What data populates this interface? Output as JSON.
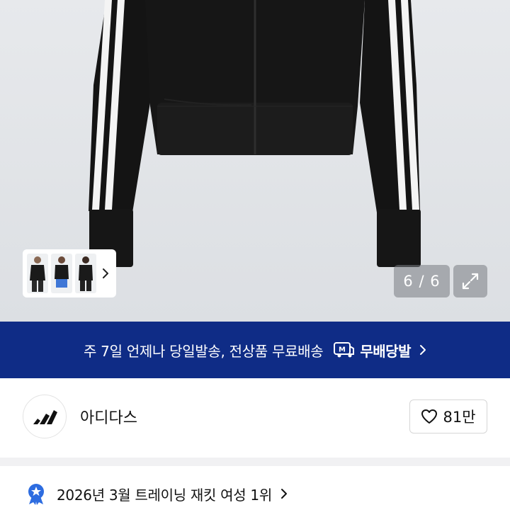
{
  "gallery": {
    "counter": "6 / 6",
    "thumbnails": [
      "thumbnail-front",
      "thumbnail-model",
      "thumbnail-back"
    ],
    "icons": {
      "more": "chevron-right-icon",
      "expand": "expand-icon"
    }
  },
  "shipping_banner": {
    "text": "주 7일 언제나 당일발송, 전상품 무료배송",
    "brand": "무배당발",
    "logo_letter": "M",
    "color": "#0f2c86"
  },
  "brand": {
    "name": "아디다스",
    "likes": "81만",
    "logo": "adidas-logo"
  },
  "ranking": {
    "text": "2026년 3월 트레이닝 재킷 여성 1위",
    "badge_color": "#2d6ce0"
  }
}
